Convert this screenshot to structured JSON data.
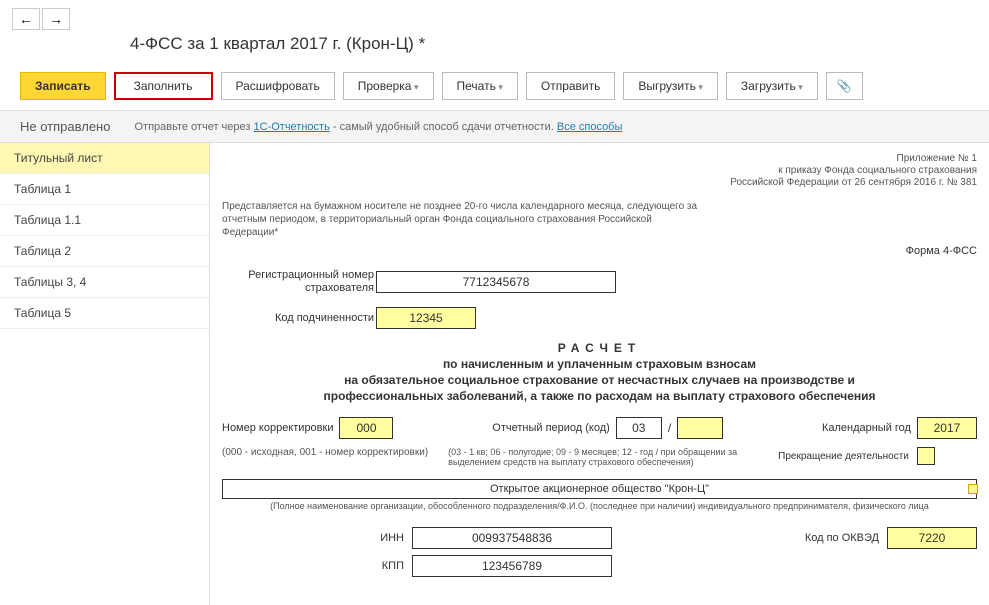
{
  "nav": {
    "back": "←",
    "forward": "→"
  },
  "title": "4-ФСС за 1 квартал 2017 г. (Крон-Ц) *",
  "toolbar": {
    "save": "Записать",
    "fill": "Заполнить",
    "decrypt": "Расшифровать",
    "check": "Проверка",
    "print": "Печать",
    "send": "Отправить",
    "export": "Выгрузить",
    "import": "Загрузить",
    "attach_icon": "📎"
  },
  "status": {
    "label": "Не отправлено",
    "msg_prefix": "Отправьте отчет через ",
    "msg_link": "1С-Отчетность",
    "msg_suffix": " - самый удобный способ сдачи отчетности. ",
    "msg_link2": "Все способы"
  },
  "sidebar": {
    "items": [
      {
        "label": "Титульный лист"
      },
      {
        "label": "Таблица 1"
      },
      {
        "label": "Таблица 1.1"
      },
      {
        "label": "Таблица 2"
      },
      {
        "label": "Таблицы 3, 4"
      },
      {
        "label": "Таблица 5"
      }
    ]
  },
  "header_right": [
    "Приложение № 1",
    "к приказу Фонда социального страхования",
    "Российской Федерации от 26 сентября 2016 г. № 381"
  ],
  "notice": "Представляется на бумажном носителе не позднее 20-го числа календарного месяца, следующего за отчетным периодом, в территориальный орган Фонда социального страхования Российской Федерации*",
  "form_name": "Форма 4-ФСС",
  "fields": {
    "reg_label": "Регистрационный номер страхователя",
    "reg_value": "7712345678",
    "code_label": "Код подчиненности",
    "code_value": "12345"
  },
  "calc_title": {
    "main": "РАСЧЕТ",
    "line2": "по начисленным и уплаченным страховым взносам",
    "line3": "на обязательное социальное страхование от несчастных случаев на производстве и",
    "line4": "профессиональных заболеваний, а также по расходам на выплату страхового обеспечения"
  },
  "period": {
    "corr_label": "Номер корректировки",
    "corr_value": "000",
    "period_label": "Отчетный период (код)",
    "period_value": "03",
    "separator": "/",
    "year_label": "Календарный год",
    "year_value": "2017"
  },
  "hints": {
    "left": "(000 - исходная, 001 - номер корректировки)",
    "center": "(03 - 1 кв; 06 - полугодие; 09 - 9 месяцев; 12 - год / при обращении за выделением средств на выплату страхового обеспечения)",
    "right_label": "Прекращение деятельности"
  },
  "org_name": "Открытое акционерное общество \"Крон-Ц\"",
  "org_subtitle": "(Полное наименование организации, обособленного подразделения/Ф.И.О. (последнее при наличии) индивидуального предпринимателя, физического лица",
  "bottom": {
    "inn_label": "ИНН",
    "inn_value": "009937548836",
    "kpp_label": "КПП",
    "kpp_value": "123456789",
    "okved_label": "Код по ОКВЭД",
    "okved_value": "7220"
  }
}
